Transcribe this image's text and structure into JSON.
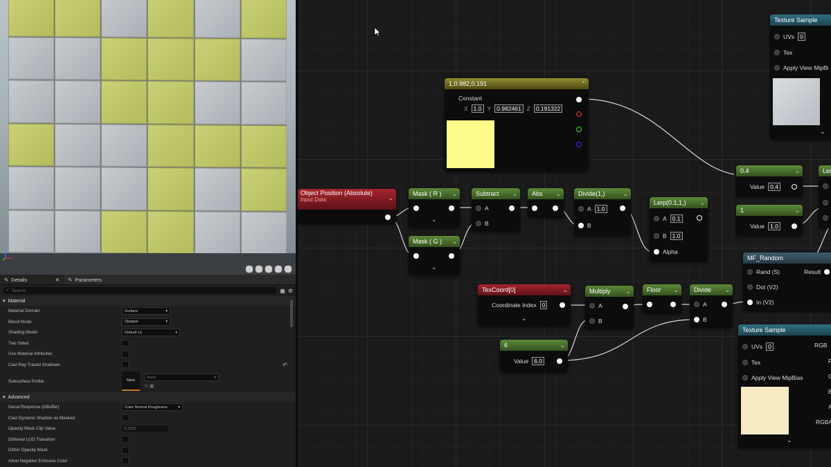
{
  "details": {
    "tab_details": "Details",
    "tab_parameters": "Parameters",
    "search_placeholder": "Search",
    "section_material": "Material",
    "section_advanced": "Advanced",
    "props": [
      {
        "label": "Material Domain",
        "value": "Surface"
      },
      {
        "label": "Blend Mode",
        "value": "Opaque"
      },
      {
        "label": "Shading Model",
        "value": "Default Lit"
      },
      {
        "label": "Two Sided",
        "value": ""
      },
      {
        "label": "Use Material Attributes",
        "value": ""
      },
      {
        "label": "Cast Ray Traced Shadows",
        "value": ""
      },
      {
        "label": "Subsurface Profile",
        "value": "None"
      }
    ],
    "subsurface_thumb": "None",
    "adv_props": [
      {
        "label": "Decal Response (DBuffer)",
        "value": "Color Normal Roughness"
      },
      {
        "label": "Cast Dynamic Shadow as Masked",
        "value": ""
      },
      {
        "label": "Opacity Mask Clip Value",
        "value": "0.3333"
      },
      {
        "label": "Dithered LOD Transition",
        "value": ""
      },
      {
        "label": "Dither Opacity Mask",
        "value": ""
      },
      {
        "label": "Allow Negative Emissive Color",
        "value": ""
      }
    ]
  },
  "nodes": {
    "constant3": {
      "title": "1,0.982,0.191",
      "label": "Constant",
      "x_label": "X",
      "x": "1.0",
      "y_label": "Y",
      "y": "0.982461",
      "z_label": "Z",
      "z": "0.191322",
      "swatch": "#fdfb8a"
    },
    "object_position": {
      "title": "Object Position  (Absolute)",
      "subtitle": "Input Data"
    },
    "mask_r": {
      "title": "Mask ( R )"
    },
    "mask_g": {
      "title": "Mask ( G )"
    },
    "subtract": {
      "title": "Subtract",
      "a": "A",
      "b": "B"
    },
    "abs": {
      "title": "Abs"
    },
    "divide1": {
      "title": "Divide(1,)",
      "a": "A",
      "a_val": "1.0",
      "b": "B"
    },
    "lerp": {
      "title": "Lerp(0.1,1,)",
      "a": "A",
      "a_val": "0.1",
      "b": "B",
      "b_val": "1.0",
      "alpha": "Alpha"
    },
    "const_04": {
      "title": "0.4",
      "label": "Value",
      "value": "0.4"
    },
    "const_1": {
      "title": "1",
      "label": "Value",
      "value": "1.0"
    },
    "lerp2": {
      "title": "Ler"
    },
    "texcoord": {
      "title": "TexCoord[0]",
      "label": "Coordinate Index",
      "value": "0"
    },
    "multiply": {
      "title": "Multiply",
      "a": "A",
      "b": "B"
    },
    "floor": {
      "title": "Floor"
    },
    "divide2": {
      "title": "Divide",
      "a": "A",
      "b": "B"
    },
    "const_6": {
      "title": "6",
      "label": "Value",
      "value": "6.0"
    },
    "mf_random": {
      "title": "MF_Random",
      "in1": "Rand (S)",
      "out": "Result",
      "in2": "Dot (V2)",
      "in3": "In (V2)"
    },
    "tex_top": {
      "title": "Texture Sample",
      "uvs": "UVs",
      "uvs_val": "0",
      "tex": "Tex",
      "mip": "Apply View MipBi"
    },
    "tex_bottom": {
      "title": "Texture Sample",
      "uvs": "UVs",
      "uvs_val": "0",
      "tex": "Tex",
      "mip": "Apply View MipBias",
      "rgb": "RGB",
      "r": "R",
      "g": "G",
      "b": "B",
      "a": "A",
      "rgba": "RGBA",
      "swatch": "#f6ebc2"
    }
  },
  "colors": {
    "accent_green": "#5c8a3a",
    "accent_red": "#a8242e",
    "accent_teal": "#2f6f80"
  }
}
